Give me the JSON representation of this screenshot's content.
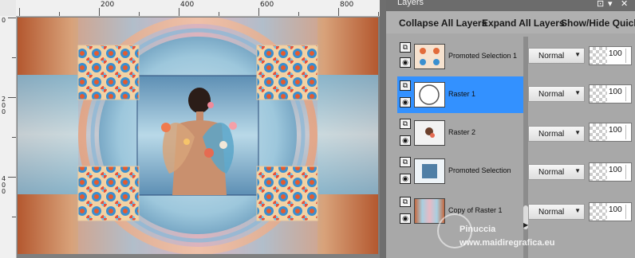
{
  "ruler": {
    "h_labels": [
      "200",
      "400",
      "600",
      "800"
    ],
    "v_labels": [
      "0",
      "2 0 0",
      "4 0 0"
    ]
  },
  "panel": {
    "title": "Layers"
  },
  "toolbar": {
    "collapse": "Collapse All Layers",
    "expand": "Expand All Layers",
    "showhide": "Show/Hide Quick"
  },
  "layers": [
    {
      "name": "Promoted Selection 1",
      "blend": "Normal",
      "opacity": "100",
      "selected": false
    },
    {
      "name": "Raster 1",
      "blend": "Normal",
      "opacity": "100",
      "selected": true
    },
    {
      "name": "Raster 2",
      "blend": "Normal",
      "opacity": "100",
      "selected": false
    },
    {
      "name": "Promoted Selection",
      "blend": "Normal",
      "opacity": "100",
      "selected": false
    },
    {
      "name": "Copy of Raster 1",
      "blend": "Normal",
      "opacity": "100",
      "selected": false
    }
  ],
  "watermark": {
    "name": "Pinuccia",
    "site": "www.maidiregrafica.eu"
  },
  "colors": {
    "selection": "#3391ff",
    "panel_bg": "#a8a8a8"
  }
}
